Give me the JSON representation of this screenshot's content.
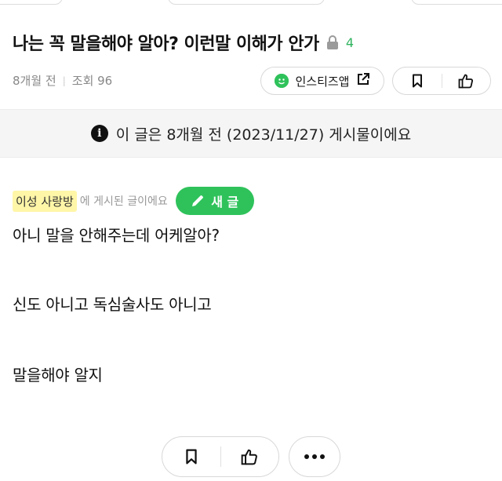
{
  "post": {
    "title": "나는 꼭 말을해야 알아? 이런말 이해가 안가",
    "comment_count": "4",
    "age": "8개월 전",
    "views": "조회 96"
  },
  "share": {
    "label": "인스티즈앱"
  },
  "notice": {
    "text": "이 글은 8개월 전 (2023/11/27) 게시물이에요"
  },
  "board": {
    "name": "이성 사랑방",
    "suffix": "에 게시된 글이에요",
    "new_post_label": "새 글"
  },
  "content": {
    "lines": [
      "아니 말을 안해주는데 어케알아?",
      "신도 아니고 독심술사도 아니고",
      "말을해야 알지"
    ]
  },
  "colors": {
    "accent_green": "#2fc25b",
    "board_highlight": "#fff6a8",
    "notice_bg": "#f5f5f6"
  },
  "icons": [
    "lock-icon",
    "leaf-icon",
    "external-link-icon",
    "bookmark-icon",
    "thumbs-up-icon",
    "info-icon",
    "pencil-icon",
    "more-icon"
  ]
}
